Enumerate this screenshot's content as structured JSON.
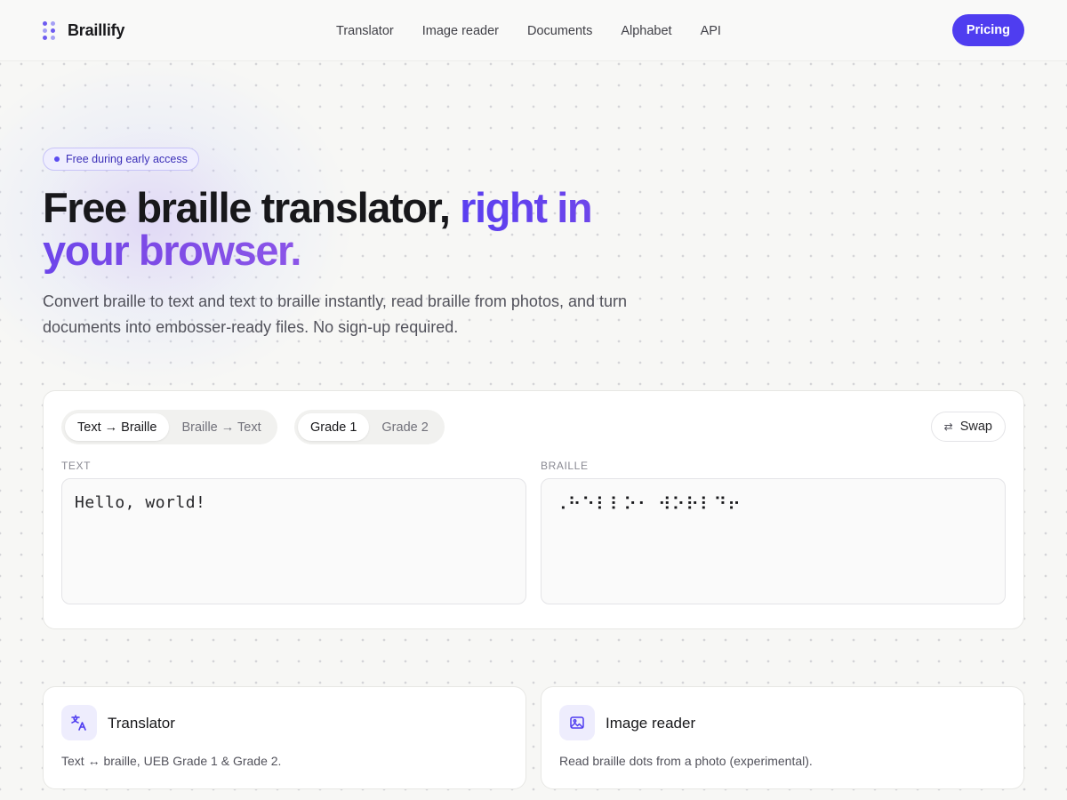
{
  "brand": {
    "name": "Braillify"
  },
  "nav": {
    "items": [
      "Translator",
      "Image reader",
      "Documents",
      "Alphabet",
      "API"
    ],
    "pricing_label": "Pricing"
  },
  "hero": {
    "badge": "Free during early access",
    "title_plain": "Free braille translator, ",
    "title_accent": "right in your browser.",
    "subtitle": "Convert braille to text and text to braille instantly, read braille from photos, and turn documents into embosser-ready files. No sign-up required."
  },
  "translator": {
    "direction_options": [
      "Text → Braille",
      "Braille → Text"
    ],
    "direction_selected": "Text → Braille",
    "grade_options": [
      "Grade 1",
      "Grade 2"
    ],
    "grade_selected": "Grade 1",
    "swap_label": "Swap",
    "text_label": "TEXT",
    "braille_label": "BRAILLE",
    "text_value": "Hello, world!",
    "braille_value": "⠠⠓⠑⠇⠇⠕⠂ ⠺⠕⠗⠇⠙⠖"
  },
  "features": [
    {
      "title": "Translator",
      "description": "Text ↔ braille, UEB Grade 1 & Grade 2.",
      "icon": "translate-icon"
    },
    {
      "title": "Image reader",
      "description": "Read braille dots from a photo (experimental).",
      "icon": "image-icon"
    }
  ],
  "colors": {
    "accent": "#4f3df0",
    "accent_gradient_end": "#8b55e8"
  }
}
